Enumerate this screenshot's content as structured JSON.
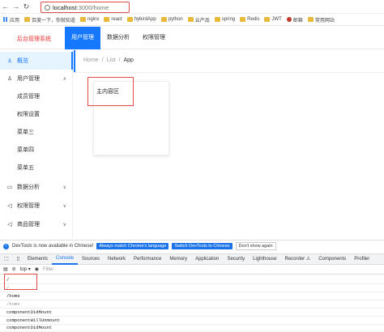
{
  "browser": {
    "url_host": "localhost",
    "url_path": ":3000/home",
    "bookmarks": [
      "应用",
      "百度一下，你就知道",
      "nginx",
      "react",
      "hybirdApp",
      "python",
      "云产品",
      "spring",
      "Redis",
      "JWT",
      "邮箱",
      "常用网站"
    ]
  },
  "header": {
    "logo": "后台管理系统",
    "menu": [
      "用户管理",
      "数据分析",
      "权限管理"
    ]
  },
  "sider": {
    "items": [
      {
        "label": "概览",
        "icon": "user-icon",
        "active": true
      },
      {
        "label": "用户管理",
        "icon": "user-icon",
        "chevron": "up"
      },
      {
        "label": "成员管理",
        "sub": true
      },
      {
        "label": "权限设置",
        "sub": true
      },
      {
        "label": "菜单三",
        "sub": true
      },
      {
        "label": "菜单四",
        "sub": true
      },
      {
        "label": "菜单五",
        "sub": true
      },
      {
        "label": "数据分析",
        "icon": "laptop-icon",
        "chevron": "down"
      },
      {
        "label": "权限管理",
        "icon": "notification-icon",
        "chevron": "down"
      },
      {
        "label": "商品管理",
        "icon": "notification-icon",
        "chevron": "down"
      }
    ]
  },
  "breadcrumb": [
    "Home",
    "List",
    "App"
  ],
  "card": {
    "text": "主内容区"
  },
  "devtools": {
    "banner_text": "DevTools is now available in Chinese!",
    "btn_match": "Always match Chrome's language",
    "btn_switch": "Switch DevTools to Chinese",
    "btn_dont": "Don't show again",
    "tabs": [
      "Elements",
      "Console",
      "Sources",
      "Network",
      "Performance",
      "Memory",
      "Application",
      "Security",
      "Lighthouse",
      "Recorder ⚠",
      "Components",
      "Profiler"
    ],
    "context": "top ▾",
    "filter_placeholder": "Filter",
    "logs": [
      {
        "text": "/",
        "dim": false
      },
      {
        "text": "/",
        "dim": true
      },
      {
        "text": "/home",
        "dim": false
      },
      {
        "text": "/home",
        "dim": true
      },
      {
        "text": "componentDidMount",
        "dim": false
      },
      {
        "text": "componentWillUnmount",
        "dim": false
      },
      {
        "text": "componentDidMount",
        "dim": false
      }
    ]
  }
}
